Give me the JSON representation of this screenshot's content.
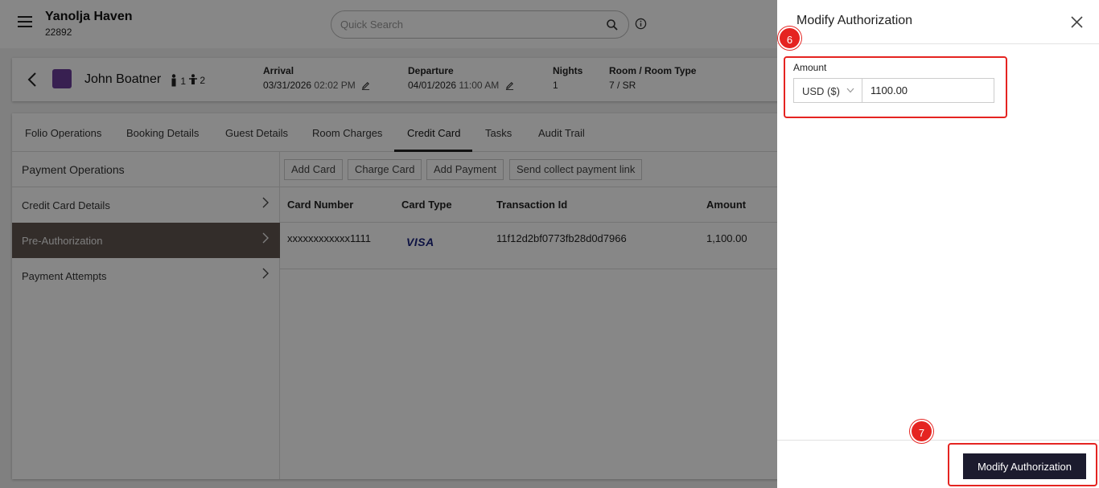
{
  "header": {
    "property_name": "Yanolja Haven",
    "property_id": "22892",
    "search_placeholder": "Quick Search"
  },
  "guest": {
    "name": "John Boatner",
    "adults": "1",
    "children": "2",
    "arrival_label": "Arrival",
    "arrival_date": "03/31/2026",
    "arrival_time": "02:02 PM",
    "departure_label": "Departure",
    "departure_date": "04/01/2026",
    "departure_time": "11:00 AM",
    "nights_label": "Nights",
    "nights_value": "1",
    "room_label": "Room / Room Type",
    "room_value": "7 / SR"
  },
  "tabs": [
    {
      "label": "Folio Operations"
    },
    {
      "label": "Booking Details"
    },
    {
      "label": "Guest Details"
    },
    {
      "label": "Room Charges"
    },
    {
      "label": "Credit Card",
      "active": true
    },
    {
      "label": "Tasks"
    },
    {
      "label": "Audit Trail"
    }
  ],
  "sidebar": {
    "title": "Payment Operations",
    "items": [
      {
        "label": "Credit Card Details"
      },
      {
        "label": "Pre-Authorization",
        "active": true
      },
      {
        "label": "Payment Attempts"
      }
    ]
  },
  "toolbar": {
    "buttons": [
      "Add Card",
      "Charge Card",
      "Add Payment",
      "Send collect payment link"
    ]
  },
  "table": {
    "columns": [
      "Card Number",
      "Card Type",
      "Transaction Id",
      "Amount"
    ],
    "rows": [
      {
        "card_number": "xxxxxxxxxxxx1111",
        "card_type": "VISA",
        "transaction_id": "11f12d2bf0773fb28d0d7966",
        "amount": "1,100.00"
      }
    ]
  },
  "drawer": {
    "title": "Modify Authorization",
    "amount_label": "Amount",
    "currency": "USD ($)",
    "amount_value": "1100.00",
    "submit_label": "Modify Authorization"
  },
  "annotations": {
    "step_a": "6",
    "step_b": "7",
    "color": "#e52421"
  }
}
